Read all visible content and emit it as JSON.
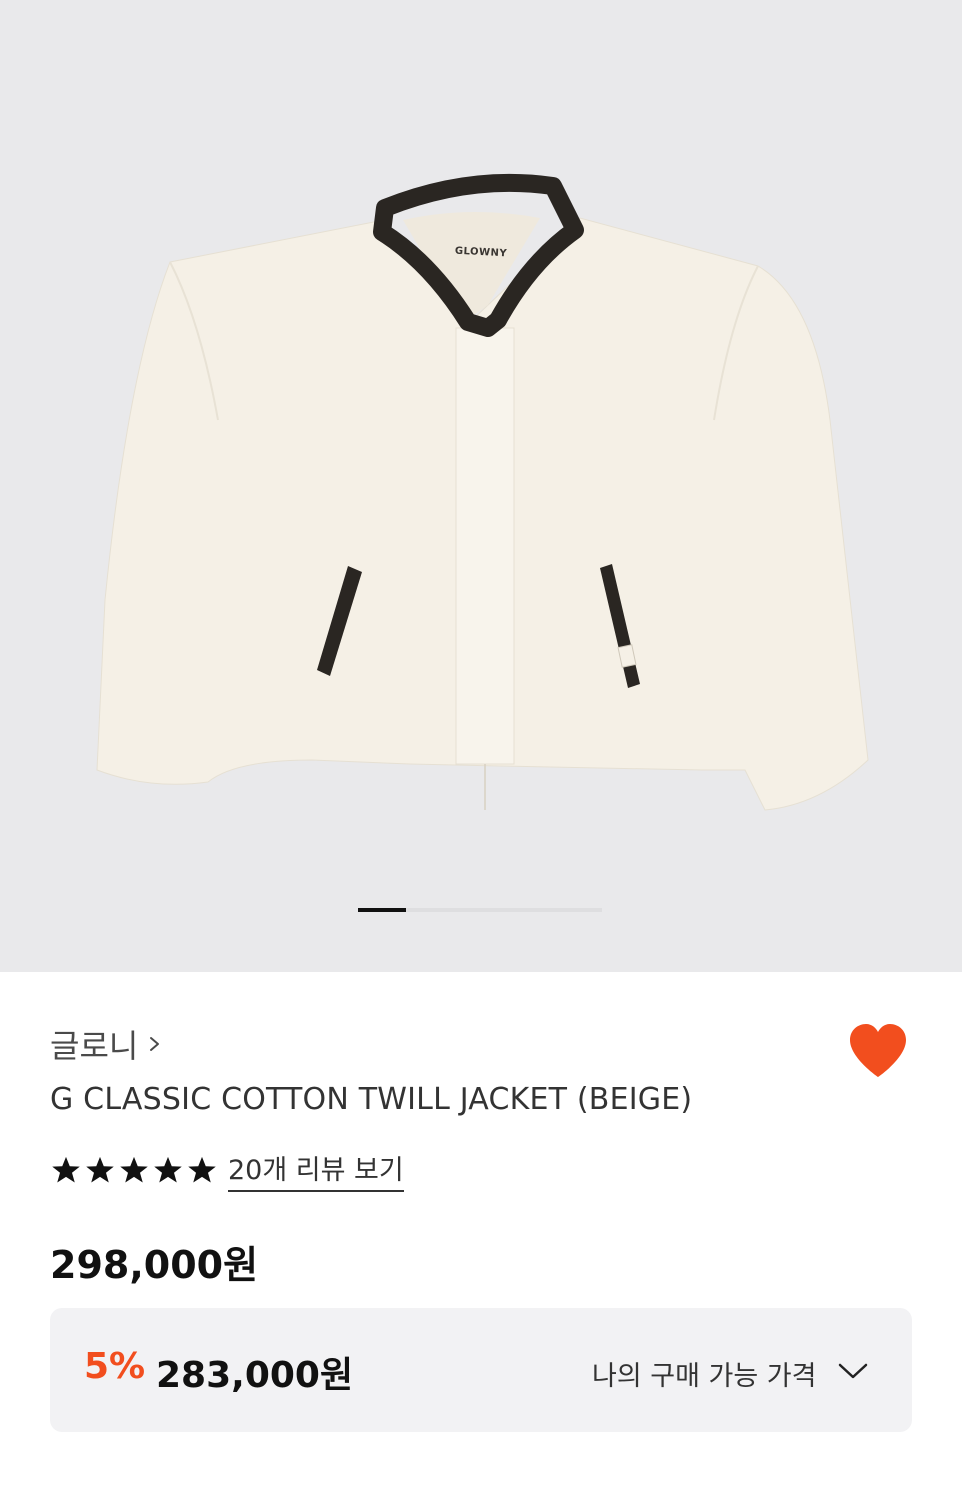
{
  "gallery": {
    "product_image_alt": "G CLASSIC COTTON TWILL JACKET (BEIGE)",
    "label_text": "GLOWNY",
    "slide_count": 5,
    "active_slide": 1
  },
  "product": {
    "brand": "글로니",
    "brand_icon": "chevron-right-icon",
    "name": "G CLASSIC COTTON TWILL JACKET (BEIGE)",
    "favorited": true,
    "heart_color": "#f24e1e"
  },
  "rating": {
    "stars": 5,
    "star_color": "#111111",
    "review_link": "20개 리뷰 보기"
  },
  "pricing": {
    "original_price": "298,000원",
    "discount_rate": "5%",
    "discount_color": "#f24e1e",
    "sale_price": "283,000원",
    "my_price_label": "나의 구매 가능 가격",
    "my_price_icon": "chevron-down-icon"
  }
}
